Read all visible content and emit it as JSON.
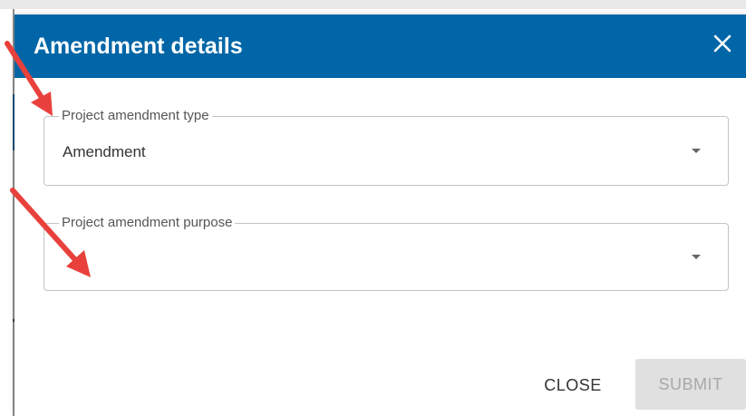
{
  "dialog": {
    "title": "Amendment details",
    "close_icon": "close-icon",
    "header_color": "#0066a7"
  },
  "fields": {
    "amendment_type": {
      "label": "Project amendment type",
      "value": "Amendment",
      "icon": "dropdown-caret-icon"
    },
    "amendment_purpose": {
      "label": "Project amendment purpose",
      "value": "",
      "icon": "dropdown-caret-icon"
    }
  },
  "actions": {
    "close_label": "CLOSE",
    "submit_label": "SUBMIT",
    "submit_state": "disabled"
  },
  "annotations": {
    "arrow_color": "#e8413d",
    "arrow_icon": "red-arrow-icon"
  }
}
